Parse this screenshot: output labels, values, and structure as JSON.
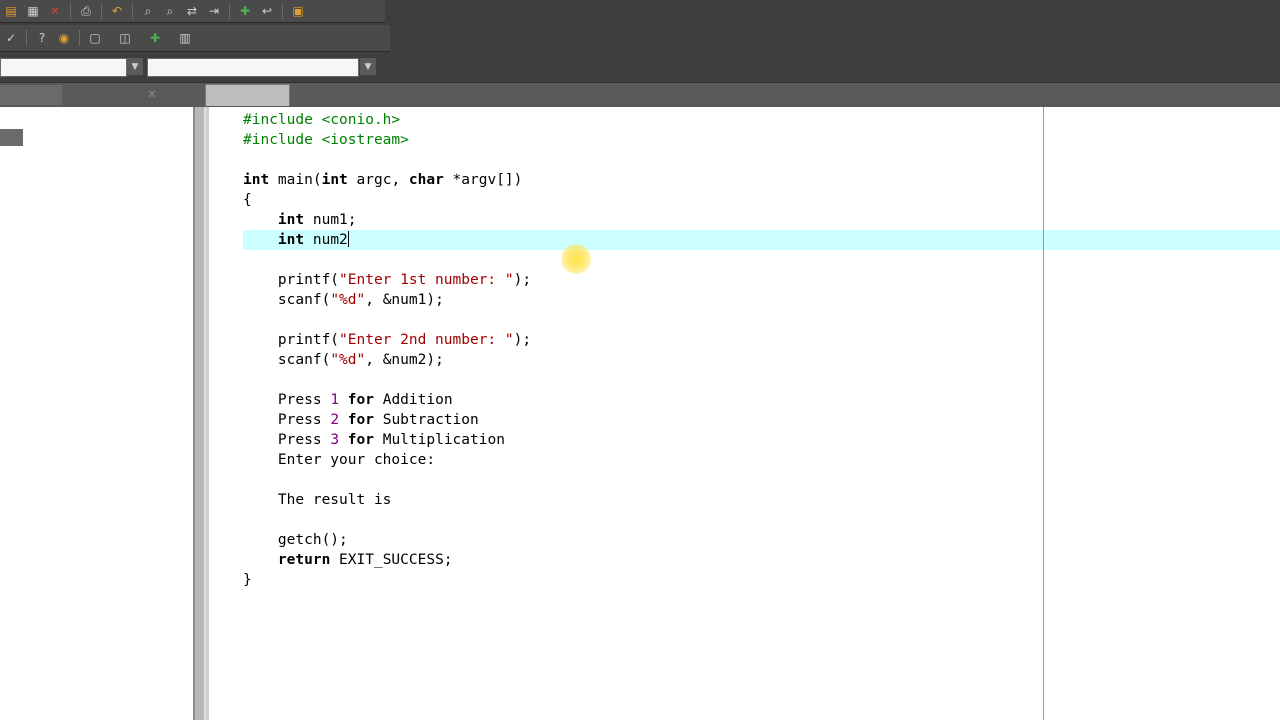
{
  "toolbar": {
    "row1_icons": [
      "open-icon",
      "save-icon",
      "close-icon",
      "print-icon",
      "undo-icon",
      "search-icon",
      "find-icon",
      "replace-icon",
      "goto-icon",
      "add-icon",
      "back-icon",
      "class-icon"
    ],
    "row2_icons": [
      "check-icon",
      "help-icon",
      "about-icon",
      "new-class-icon",
      "new-member-icon",
      "add-project-icon",
      "project-options-icon"
    ]
  },
  "tabs": {
    "left_tab": "",
    "file_tab": ""
  },
  "editor": {
    "lines": [
      {
        "parts": [
          {
            "t": "#include <conio.h>",
            "c": "pp"
          }
        ]
      },
      {
        "parts": [
          {
            "t": "#include <iostream>",
            "c": "pp"
          }
        ]
      },
      {
        "parts": []
      },
      {
        "parts": [
          {
            "t": "int",
            "c": "kw"
          },
          {
            "t": " main("
          },
          {
            "t": "int",
            "c": "kw"
          },
          {
            "t": " argc, "
          },
          {
            "t": "char",
            "c": "kw"
          },
          {
            "t": " *argv[])"
          }
        ]
      },
      {
        "parts": [
          {
            "t": "{"
          }
        ]
      },
      {
        "parts": [
          {
            "t": "    "
          },
          {
            "t": "int",
            "c": "kw"
          },
          {
            "t": " num1;"
          }
        ]
      },
      {
        "parts": [
          {
            "t": "    "
          },
          {
            "t": "int",
            "c": "kw"
          },
          {
            "t": " num2"
          }
        ],
        "caret": true
      },
      {
        "parts": []
      },
      {
        "parts": [
          {
            "t": "    printf("
          },
          {
            "t": "\"Enter 1st number: \"",
            "c": "str"
          },
          {
            "t": ");"
          }
        ]
      },
      {
        "parts": [
          {
            "t": "    scanf("
          },
          {
            "t": "\"%d\"",
            "c": "str"
          },
          {
            "t": ", &num1);"
          }
        ]
      },
      {
        "parts": []
      },
      {
        "parts": [
          {
            "t": "    printf("
          },
          {
            "t": "\"Enter 2nd number: \"",
            "c": "str"
          },
          {
            "t": ");"
          }
        ]
      },
      {
        "parts": [
          {
            "t": "    scanf("
          },
          {
            "t": "\"%d\"",
            "c": "str"
          },
          {
            "t": ", &num2);"
          }
        ]
      },
      {
        "parts": []
      },
      {
        "parts": [
          {
            "t": "    Press "
          },
          {
            "t": "1",
            "c": "num"
          },
          {
            "t": " "
          },
          {
            "t": "for",
            "c": "kw"
          },
          {
            "t": " Addition"
          }
        ]
      },
      {
        "parts": [
          {
            "t": "    Press "
          },
          {
            "t": "2",
            "c": "num"
          },
          {
            "t": " "
          },
          {
            "t": "for",
            "c": "kw"
          },
          {
            "t": " Subtraction"
          }
        ]
      },
      {
        "parts": [
          {
            "t": "    Press "
          },
          {
            "t": "3",
            "c": "num"
          },
          {
            "t": " "
          },
          {
            "t": "for",
            "c": "kw"
          },
          {
            "t": " Multiplication"
          }
        ]
      },
      {
        "parts": [
          {
            "t": "    Enter your choice:"
          }
        ]
      },
      {
        "parts": []
      },
      {
        "parts": [
          {
            "t": "    The result is"
          }
        ]
      },
      {
        "parts": []
      },
      {
        "parts": [
          {
            "t": "    getch();"
          }
        ]
      },
      {
        "parts": [
          {
            "t": "    "
          },
          {
            "t": "return",
            "c": "kw"
          },
          {
            "t": " EXIT_SUCCESS;"
          }
        ]
      },
      {
        "parts": [
          {
            "t": "}"
          }
        ]
      }
    ],
    "colors": {
      "preprocessor": "#008000",
      "string": "#a00000",
      "number": "#800080",
      "current_line": "#ccffff"
    }
  }
}
